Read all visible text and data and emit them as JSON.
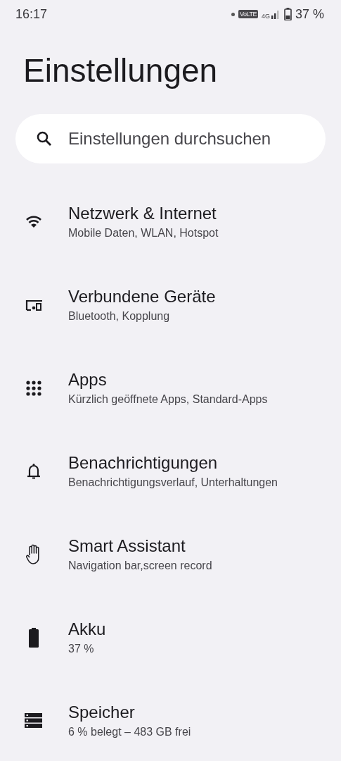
{
  "status_bar": {
    "time": "16:17",
    "volte": "VoLTE",
    "network": "4G",
    "battery": "37 %"
  },
  "title": "Einstellungen",
  "search": {
    "placeholder": "Einstellungen durchsuchen"
  },
  "items": [
    {
      "kind": "wifi",
      "title": "Netzwerk & Internet",
      "subtitle": "Mobile Daten, WLAN, Hotspot"
    },
    {
      "kind": "devices",
      "title": "Verbundene Geräte",
      "subtitle": "Bluetooth, Kopplung"
    },
    {
      "kind": "apps",
      "title": "Apps",
      "subtitle": "Kürzlich geöffnete Apps, Standard-Apps"
    },
    {
      "kind": "bell",
      "title": "Benachrichtigungen",
      "subtitle": "Benachrichtigungsverlauf, Unterhaltungen"
    },
    {
      "kind": "hand",
      "title": "Smart Assistant",
      "subtitle": "Navigation bar,screen record"
    },
    {
      "kind": "battery",
      "title": "Akku",
      "subtitle": "37 %"
    },
    {
      "kind": "storage",
      "title": "Speicher",
      "subtitle": "6 % belegt – 483 GB frei"
    }
  ]
}
